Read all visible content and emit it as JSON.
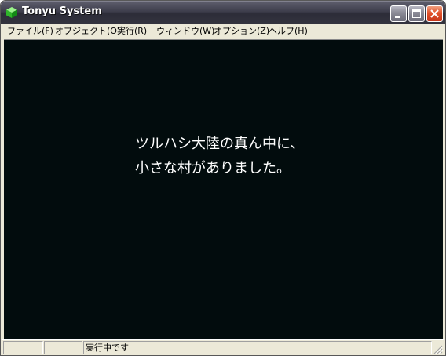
{
  "window": {
    "title": "Tonyu System",
    "app_icon": "green-cube-icon",
    "controls": {
      "minimize": "minimize-icon",
      "maximize": "maximize-icon",
      "close": "close-icon"
    },
    "close_color": "#e2532b"
  },
  "menu": {
    "file": {
      "label": "ファイル",
      "accel": "(F)"
    },
    "object": {
      "label": "オブジェクト",
      "accel": "(O)"
    },
    "run": {
      "label": "実行",
      "accel": "(R)"
    },
    "window": {
      "label": "ウィンドウ",
      "accel": "(W)"
    },
    "option": {
      "label": "オプション",
      "accel": "(Z)"
    },
    "help": {
      "label": "ヘルプ",
      "accel": "(H)"
    }
  },
  "screen": {
    "background": "#020c0d",
    "lines": [
      "ツルハシ大陸の真ん中に、",
      "小さな村がありました。"
    ]
  },
  "status": {
    "pane1": "",
    "pane2": "",
    "pane3": "実行中です"
  }
}
